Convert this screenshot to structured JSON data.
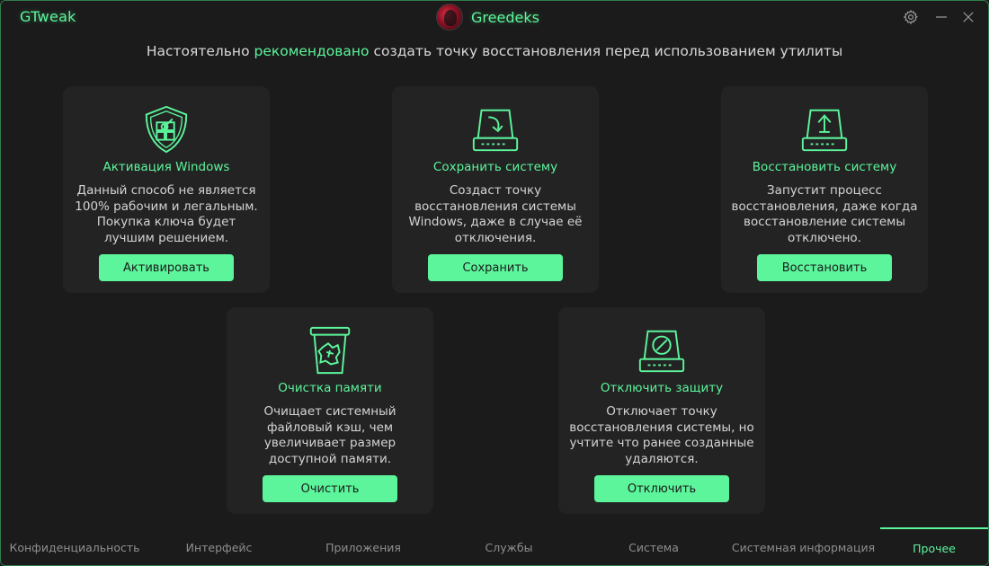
{
  "app": {
    "title": "GTweak",
    "brand_name": "Greedeks",
    "accent_color": "#5cf59b",
    "background_color": "#1b1b1b",
    "card_color": "#232323"
  },
  "titlebar_icons": [
    "gear-icon",
    "minimize-icon",
    "close-icon"
  ],
  "notice": {
    "before": "Настоятельно ",
    "highlight": "рекомендовано",
    "after": " создать точку восстановления перед использованием утилиты"
  },
  "cards": [
    {
      "icon": "shield-windows-icon",
      "title": "Активация Windows",
      "desc": "Данный способ не является 100% рабочим и легальным. Покупка ключа будет лучшим решением.",
      "button": "Активировать"
    },
    {
      "icon": "drive-save-icon",
      "title": "Сохранить систему",
      "desc": "Создаст точку восстановления системы Windows, даже в случае её отключения.",
      "button": "Сохранить"
    },
    {
      "icon": "drive-restore-icon",
      "title": "Восстановить систему",
      "desc": "Запустит процесс восстановления, даже когда восстановление системы отключено.",
      "button": "Восстановить"
    },
    {
      "icon": "trash-icon",
      "title": "Очистка памяти",
      "desc": "Очищает системный файловый кэш, чем увеличивает размер доступной памяти.",
      "button": "Очистить"
    },
    {
      "icon": "drive-disable-icon",
      "title": "Отключить защиту",
      "desc": "Отключает точку восстановления системы, но учтите что ранее созданные удаляются.",
      "button": "Отключить"
    }
  ],
  "nav": {
    "items": [
      "Конфиденциальность",
      "Интерфейс",
      "Приложения",
      "Службы",
      "Система",
      "Системная информация",
      "Прочее"
    ],
    "active": "Прочее"
  }
}
